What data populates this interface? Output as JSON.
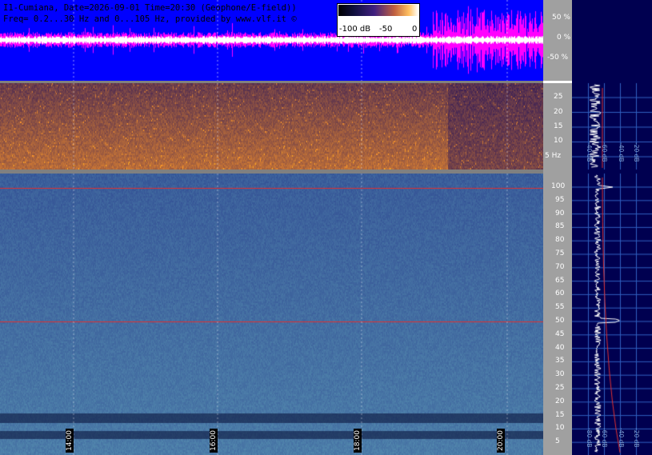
{
  "header": {
    "line1": "I1-Cumiana, Date=2026-09-01 Time=20:30 (Geophone/E-field))",
    "line2": "Freq= 0.2...30 Hz and 0...105 Hz, provided by www.vlf.it ©"
  },
  "colorbar": {
    "labels": [
      "-100 dB",
      "-50",
      "0"
    ]
  },
  "waveform_axis": {
    "labels": [
      "50 %",
      "0 %",
      "-50 %"
    ]
  },
  "low_freq_axis": {
    "labels": [
      "25",
      "20",
      "15",
      "10",
      "5 Hz"
    ]
  },
  "high_freq_axis": {
    "labels": [
      "100",
      "95",
      "90",
      "85",
      "80",
      "75",
      "70",
      "65",
      "60",
      "55",
      "50",
      "45",
      "40",
      "35",
      "30",
      "25",
      "20",
      "15",
      "10",
      "5"
    ]
  },
  "time_labels": [
    "14:00",
    "16:00",
    "18:00",
    "20:00"
  ],
  "spectrum_labels": {
    "top": [
      "-40 dB",
      "-60 dB",
      "-40 dB",
      "-20 dB"
    ],
    "bottom": [
      "-80 dB",
      "-60 dB",
      "-40 dB",
      "-20 dB"
    ]
  },
  "colors": {
    "waveform_bg": "#0000ff",
    "waveform_trace": "#ff00ff",
    "axis_bg": "#a0a0a0",
    "spectrum_bg": "#000050",
    "grid": "#3060c0"
  }
}
